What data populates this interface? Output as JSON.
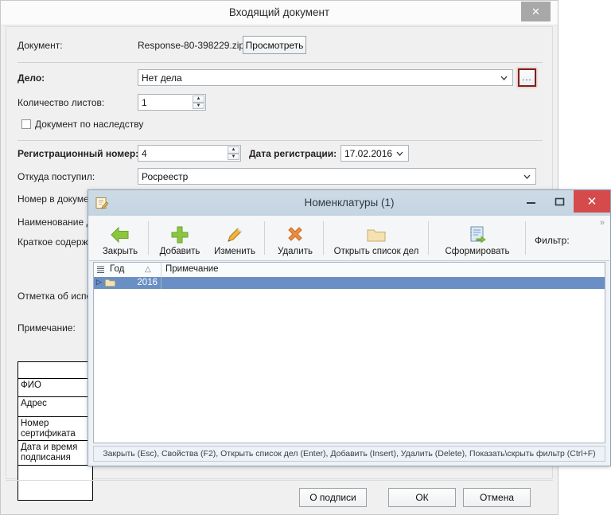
{
  "outer_window": {
    "title": "Входящий документ",
    "close_icon": "✕",
    "fields": {
      "document_label": "Документ:",
      "document_filename": "Response-80-398229.zip",
      "preview_button": "Просмотреть",
      "case_label": "Дело:",
      "case_value": "Нет дела",
      "case_browse_button": "...",
      "sheets_label": "Количество листов:",
      "sheets_value": "1",
      "inherited_checkbox_label": "Документ по наследству",
      "reg_number_label": "Регистрационный номер:",
      "reg_number_value": "4",
      "reg_date_label": "Дата регистрации:",
      "reg_date_value": "17.02.2016",
      "source_label": "Откуда поступил:",
      "source_value": "Росреестр",
      "doc_number_label": "Номер в документе:",
      "doc_name_label": "Наименование документа:",
      "summary_label": "Краткое содержание:",
      "execution_label": "Отметка об исполнении:",
      "note_label": "Примечание:"
    },
    "signature_table": {
      "rows": [
        "",
        "ФИО",
        "Адрес",
        "Номер сертификата",
        "Дата и время подписания",
        ""
      ]
    },
    "footer_buttons": {
      "about_signature": "О подписи",
      "ok": "ОК",
      "cancel": "Отмена"
    }
  },
  "inner_window": {
    "title": "Номенклатуры (1)",
    "icon": "notepad-pencil-icon",
    "minimize_icon": "–",
    "maximize_icon": "□",
    "close_icon": "✕",
    "toolbar": {
      "buttons": [
        {
          "label": "Закрыть",
          "icon": "green-left-arrow-icon"
        },
        {
          "label": "Добавить",
          "icon": "green-plus-icon"
        },
        {
          "label": "Изменить",
          "icon": "pencil-icon"
        },
        {
          "label": "Удалить",
          "icon": "orange-cross-icon"
        },
        {
          "label": "Открыть список дел",
          "icon": "folder-icon"
        },
        {
          "label": "Сформировать",
          "icon": "blue-notebook-green-arrow-icon"
        }
      ],
      "filter_label": "Фильтр:",
      "overflow_chevron": "»"
    },
    "grid": {
      "columns": [
        "Год",
        "Примечание"
      ],
      "sort_indicator": "△",
      "rows": [
        {
          "year": "2016",
          "note": "",
          "icon": "folder-icon",
          "expander": "▷",
          "selected": true
        }
      ]
    },
    "status_bar": "Закрыть (Esc), Свойства (F2), Открыть список дел (Enter), Добавить (Insert), Удалить (Delete), Показать\\скрыть фильтр (Ctrl+F)"
  },
  "colors": {
    "inner_titlebar": "#c9d8e4",
    "close_red": "#d54b4b",
    "row_selected": "#6a8fc4",
    "focus_outline": "#7e2020",
    "accent_green": "#7cb342"
  }
}
